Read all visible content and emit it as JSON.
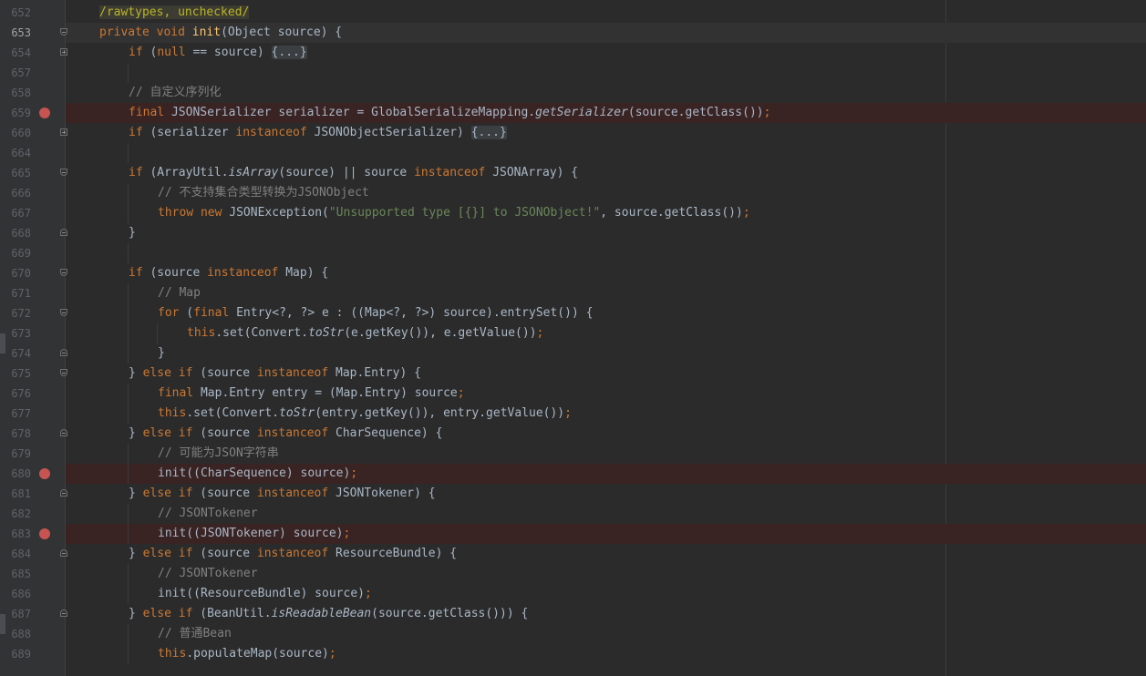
{
  "editor": {
    "colors": {
      "background": "#2b2b2b",
      "gutter": "#313335",
      "keyword": "#cc7832",
      "string": "#6a8759",
      "comment": "#808080",
      "method_decl": "#ffc66d",
      "breakpoint": "#c75450"
    },
    "lines": [
      {
        "n": "652",
        "t": [
          {
            "s": "/rawtypes, unchecked/",
            "c": "anno"
          }
        ],
        "ind": 0
      },
      {
        "n": "653",
        "cur": true,
        "fold": "minus-open",
        "t": [
          {
            "s": "private",
            "c": "kw"
          },
          {
            "s": " "
          },
          {
            "s": "void",
            "c": "kw"
          },
          {
            "s": " "
          },
          {
            "s": "init",
            "c": "fn"
          },
          {
            "s": "(Object source) {"
          }
        ],
        "ind": 0
      },
      {
        "n": "654",
        "fold": "plus",
        "t": [
          {
            "s": "if",
            "c": "kw"
          },
          {
            "s": " ("
          },
          {
            "s": "null",
            "c": "kw"
          },
          {
            "s": " == source) "
          },
          {
            "s": "{...}",
            "c": "fold-text"
          }
        ],
        "ind": 1
      },
      {
        "n": "657",
        "t": [],
        "ind": 1
      },
      {
        "n": "658",
        "t": [
          {
            "s": "// 自定义序列化",
            "c": "cmt"
          }
        ],
        "ind": 1
      },
      {
        "n": "659",
        "bp": true,
        "t": [
          {
            "s": "final",
            "c": "kw"
          },
          {
            "s": " JSONSerializer serializer = GlobalSerializeMapping."
          },
          {
            "s": "getSerializer",
            "c": "it"
          },
          {
            "s": "(source.getClass())"
          },
          {
            "s": ";",
            "c": "kw"
          }
        ],
        "ind": 1
      },
      {
        "n": "660",
        "fold": "plus",
        "t": [
          {
            "s": "if",
            "c": "kw"
          },
          {
            "s": " (serializer "
          },
          {
            "s": "instanceof",
            "c": "kw"
          },
          {
            "s": " JSONObjectSerializer) "
          },
          {
            "s": "{...}",
            "c": "fold-text"
          }
        ],
        "ind": 1
      },
      {
        "n": "664",
        "t": [],
        "ind": 1
      },
      {
        "n": "665",
        "fold": "open",
        "t": [
          {
            "s": "if",
            "c": "kw"
          },
          {
            "s": " (ArrayUtil."
          },
          {
            "s": "isArray",
            "c": "it"
          },
          {
            "s": "(source) || source "
          },
          {
            "s": "instanceof",
            "c": "kw"
          },
          {
            "s": " JSONArray) {"
          }
        ],
        "ind": 1
      },
      {
        "n": "666",
        "t": [
          {
            "s": "// 不支持集合类型转换为JSONObject",
            "c": "cmt"
          }
        ],
        "ind": 2
      },
      {
        "n": "667",
        "t": [
          {
            "s": "throw",
            "c": "kw"
          },
          {
            "s": " "
          },
          {
            "s": "new",
            "c": "kw"
          },
          {
            "s": " JSONException("
          },
          {
            "s": "\"Unsupported type [{}] to JSONObject!\"",
            "c": "str"
          },
          {
            "s": ", source.getClass())"
          },
          {
            "s": ";",
            "c": "kw"
          }
        ],
        "ind": 2
      },
      {
        "n": "668",
        "fold": "close",
        "t": [
          {
            "s": "}"
          }
        ],
        "ind": 1
      },
      {
        "n": "669",
        "t": [],
        "ind": 1
      },
      {
        "n": "670",
        "fold": "open",
        "t": [
          {
            "s": "if",
            "c": "kw"
          },
          {
            "s": " (source "
          },
          {
            "s": "instanceof",
            "c": "kw"
          },
          {
            "s": " Map) {"
          }
        ],
        "ind": 1
      },
      {
        "n": "671",
        "t": [
          {
            "s": "// Map",
            "c": "cmt"
          }
        ],
        "ind": 2
      },
      {
        "n": "672",
        "fold": "open",
        "t": [
          {
            "s": "for",
            "c": "kw"
          },
          {
            "s": " ("
          },
          {
            "s": "final",
            "c": "kw"
          },
          {
            "s": " Entry<?, ?> e : ((Map<?, ?>) source).entrySet()) {"
          }
        ],
        "ind": 2
      },
      {
        "n": "673",
        "t": [
          {
            "s": "this",
            "c": "kw"
          },
          {
            "s": ".set(Convert."
          },
          {
            "s": "toStr",
            "c": "it"
          },
          {
            "s": "(e.getKey()), e.getValue())"
          },
          {
            "s": ";",
            "c": "kw"
          }
        ],
        "ind": 3
      },
      {
        "n": "674",
        "fold": "close",
        "t": [
          {
            "s": "}"
          }
        ],
        "ind": 2
      },
      {
        "n": "675",
        "fold": "open",
        "t": [
          {
            "s": "} "
          },
          {
            "s": "else if",
            "c": "kw"
          },
          {
            "s": " (source "
          },
          {
            "s": "instanceof",
            "c": "kw"
          },
          {
            "s": " Map.Entry) {"
          }
        ],
        "ind": 1
      },
      {
        "n": "676",
        "t": [
          {
            "s": "final",
            "c": "kw"
          },
          {
            "s": " Map.Entry entry = (Map.Entry) source"
          },
          {
            "s": ";",
            "c": "kw"
          }
        ],
        "ind": 2
      },
      {
        "n": "677",
        "t": [
          {
            "s": "this",
            "c": "kw"
          },
          {
            "s": ".set(Convert."
          },
          {
            "s": "toStr",
            "c": "it"
          },
          {
            "s": "(entry.getKey()), entry.getValue())"
          },
          {
            "s": ";",
            "c": "kw"
          }
        ],
        "ind": 2
      },
      {
        "n": "678",
        "fold": "minus",
        "t": [
          {
            "s": "} "
          },
          {
            "s": "else if",
            "c": "kw"
          },
          {
            "s": " (source "
          },
          {
            "s": "instanceof",
            "c": "kw"
          },
          {
            "s": " CharSequence) {"
          }
        ],
        "ind": 1
      },
      {
        "n": "679",
        "t": [
          {
            "s": "// 可能为JSON字符串",
            "c": "cmt"
          }
        ],
        "ind": 2
      },
      {
        "n": "680",
        "bp": true,
        "t": [
          {
            "s": "init((CharSequence) source)"
          },
          {
            "s": ";",
            "c": "kw"
          }
        ],
        "ind": 2
      },
      {
        "n": "681",
        "fold": "minus",
        "t": [
          {
            "s": "} "
          },
          {
            "s": "else if",
            "c": "kw"
          },
          {
            "s": " (source "
          },
          {
            "s": "instanceof",
            "c": "kw"
          },
          {
            "s": " JSONTokener) {"
          }
        ],
        "ind": 1
      },
      {
        "n": "682",
        "t": [
          {
            "s": "// JSONTokener",
            "c": "cmt"
          }
        ],
        "ind": 2
      },
      {
        "n": "683",
        "bp": true,
        "t": [
          {
            "s": "init((JSONTokener) source)"
          },
          {
            "s": ";",
            "c": "kw"
          }
        ],
        "ind": 2
      },
      {
        "n": "684",
        "fold": "minus",
        "t": [
          {
            "s": "} "
          },
          {
            "s": "else if",
            "c": "kw"
          },
          {
            "s": " (source "
          },
          {
            "s": "instanceof",
            "c": "kw"
          },
          {
            "s": " ResourceBundle) {"
          }
        ],
        "ind": 1
      },
      {
        "n": "685",
        "t": [
          {
            "s": "// JSONTokener",
            "c": "cmt"
          }
        ],
        "ind": 2
      },
      {
        "n": "686",
        "t": [
          {
            "s": "init((ResourceBundle) source)"
          },
          {
            "s": ";",
            "c": "kw"
          }
        ],
        "ind": 2
      },
      {
        "n": "687",
        "fold": "minus",
        "t": [
          {
            "s": "} "
          },
          {
            "s": "else if",
            "c": "kw"
          },
          {
            "s": " (BeanUtil."
          },
          {
            "s": "isReadableBean",
            "c": "it"
          },
          {
            "s": "(source.getClass())) {"
          }
        ],
        "ind": 1
      },
      {
        "n": "688",
        "t": [
          {
            "s": "// 普通Bean",
            "c": "cmt"
          }
        ],
        "ind": 2
      },
      {
        "n": "689",
        "t": [
          {
            "s": "this",
            "c": "kw"
          },
          {
            "s": ".populateMap(source)"
          },
          {
            "s": ";",
            "c": "kw"
          }
        ],
        "ind": 2
      }
    ]
  }
}
